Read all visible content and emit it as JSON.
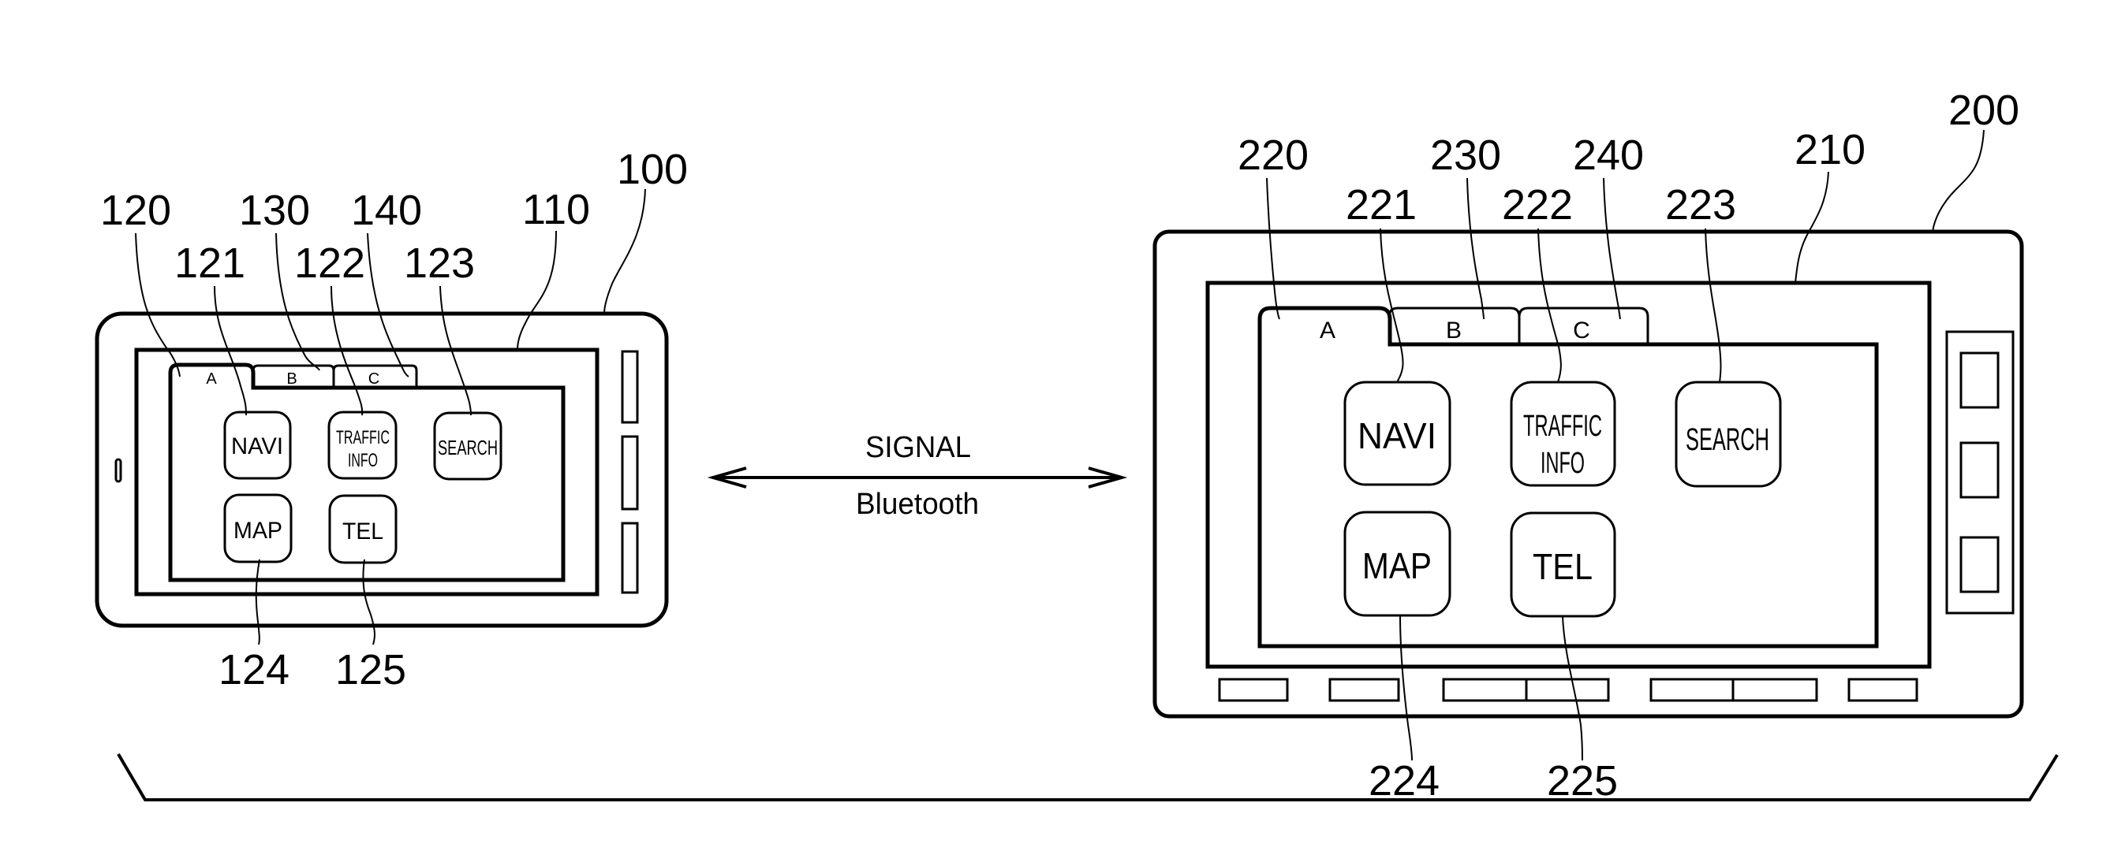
{
  "figure": {
    "type": "patent-drawing",
    "colors": {
      "ink": "#000000",
      "paper": "#ffffff"
    }
  },
  "connection": {
    "top_label": "SIGNAL",
    "bottom_label": "Bluetooth",
    "icon": "double-headed-arrow-icon"
  },
  "phone": {
    "ref": "100",
    "screen_ref": "110",
    "tab_area_ref": "120",
    "tabs": [
      {
        "label": "A",
        "ref": "120",
        "active": true
      },
      {
        "label": "B",
        "ref": "130",
        "active": false
      },
      {
        "label": "C",
        "ref": "140",
        "active": false
      }
    ],
    "buttons": [
      {
        "label_lines": [
          "NAVI"
        ],
        "ref": "121"
      },
      {
        "label_lines": [
          "TRAFFIC",
          "INFO"
        ],
        "ref": "122"
      },
      {
        "label_lines": [
          "SEARCH"
        ],
        "ref": "123"
      },
      {
        "label_lines": [
          "MAP"
        ],
        "ref": "124"
      },
      {
        "label_lines": [
          "TEL"
        ],
        "ref": "125"
      }
    ],
    "side_keys_count": 3
  },
  "head_unit": {
    "ref": "200",
    "screen_ref": "210",
    "tabs": [
      {
        "label": "A",
        "ref": "220",
        "active": true
      },
      {
        "label": "B",
        "ref": "230",
        "active": false
      },
      {
        "label": "C",
        "ref": "240",
        "active": false
      }
    ],
    "buttons": [
      {
        "label_lines": [
          "NAVI"
        ],
        "ref": "221"
      },
      {
        "label_lines": [
          "TRAFFIC",
          "INFO"
        ],
        "ref": "222"
      },
      {
        "label_lines": [
          "SEARCH"
        ],
        "ref": "223"
      },
      {
        "label_lines": [
          "MAP"
        ],
        "ref": "224"
      },
      {
        "label_lines": [
          "TEL"
        ],
        "ref": "225"
      }
    ],
    "side_keys_count": 3,
    "bottom_keys": [
      {
        "segments": 1
      },
      {
        "segments": 1
      },
      {
        "segments": 2
      },
      {
        "segments": 2
      },
      {
        "segments": 1
      }
    ]
  }
}
